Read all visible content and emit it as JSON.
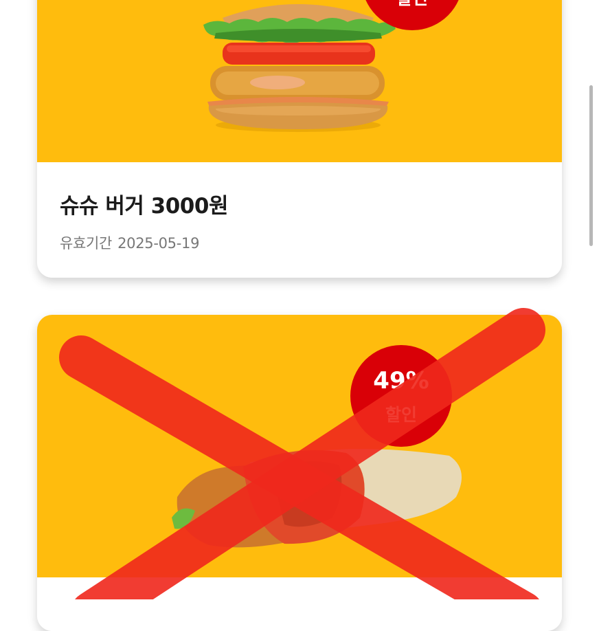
{
  "coupons": [
    {
      "image_alt": "슈슈 버거",
      "badge": {
        "percent": "",
        "label": "할인"
      },
      "title": "슈슈 버거 3000원",
      "validity_label": "유효기간",
      "validity_date": "2025-05-19",
      "crossed_out": false
    },
    {
      "image_alt": "맥랩",
      "badge": {
        "percent": "49%",
        "label": "할인"
      },
      "title": "",
      "validity_label": "",
      "validity_date": "",
      "crossed_out": true
    }
  ],
  "colors": {
    "card_background": "#FFBC0D",
    "badge": "#D90007",
    "strike": "#F0281C"
  }
}
